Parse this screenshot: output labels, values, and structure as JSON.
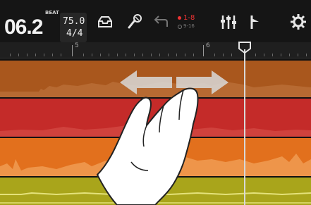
{
  "toolbar": {
    "time_display": "06.2",
    "beat_label": "BEAT",
    "tempo": "75.0",
    "time_signature": "4/4",
    "input_range_primary": "1-8",
    "input_range_secondary": "9-16",
    "icons": [
      "project-icon",
      "mic-icon",
      "undo-icon",
      "input-indicator",
      "mixer-icon",
      "marker-icon",
      "settings-icon"
    ]
  },
  "ruler": {
    "bar_numbers": [
      "5",
      "6"
    ]
  },
  "tracks": [
    {
      "name": "track-1",
      "color": "#a9571d"
    },
    {
      "name": "track-2",
      "color": "#c42b29"
    },
    {
      "name": "track-3",
      "color": "#e2701d"
    },
    {
      "name": "track-4",
      "color": "#a9a51b"
    }
  ],
  "gesture": {
    "type": "pinch-out-zoom",
    "arrow_color": "#d9d9d9"
  },
  "colors": {
    "toolbar_bg": "#151515",
    "accent_red": "#e33333",
    "playhead": "#d8d8d8"
  }
}
